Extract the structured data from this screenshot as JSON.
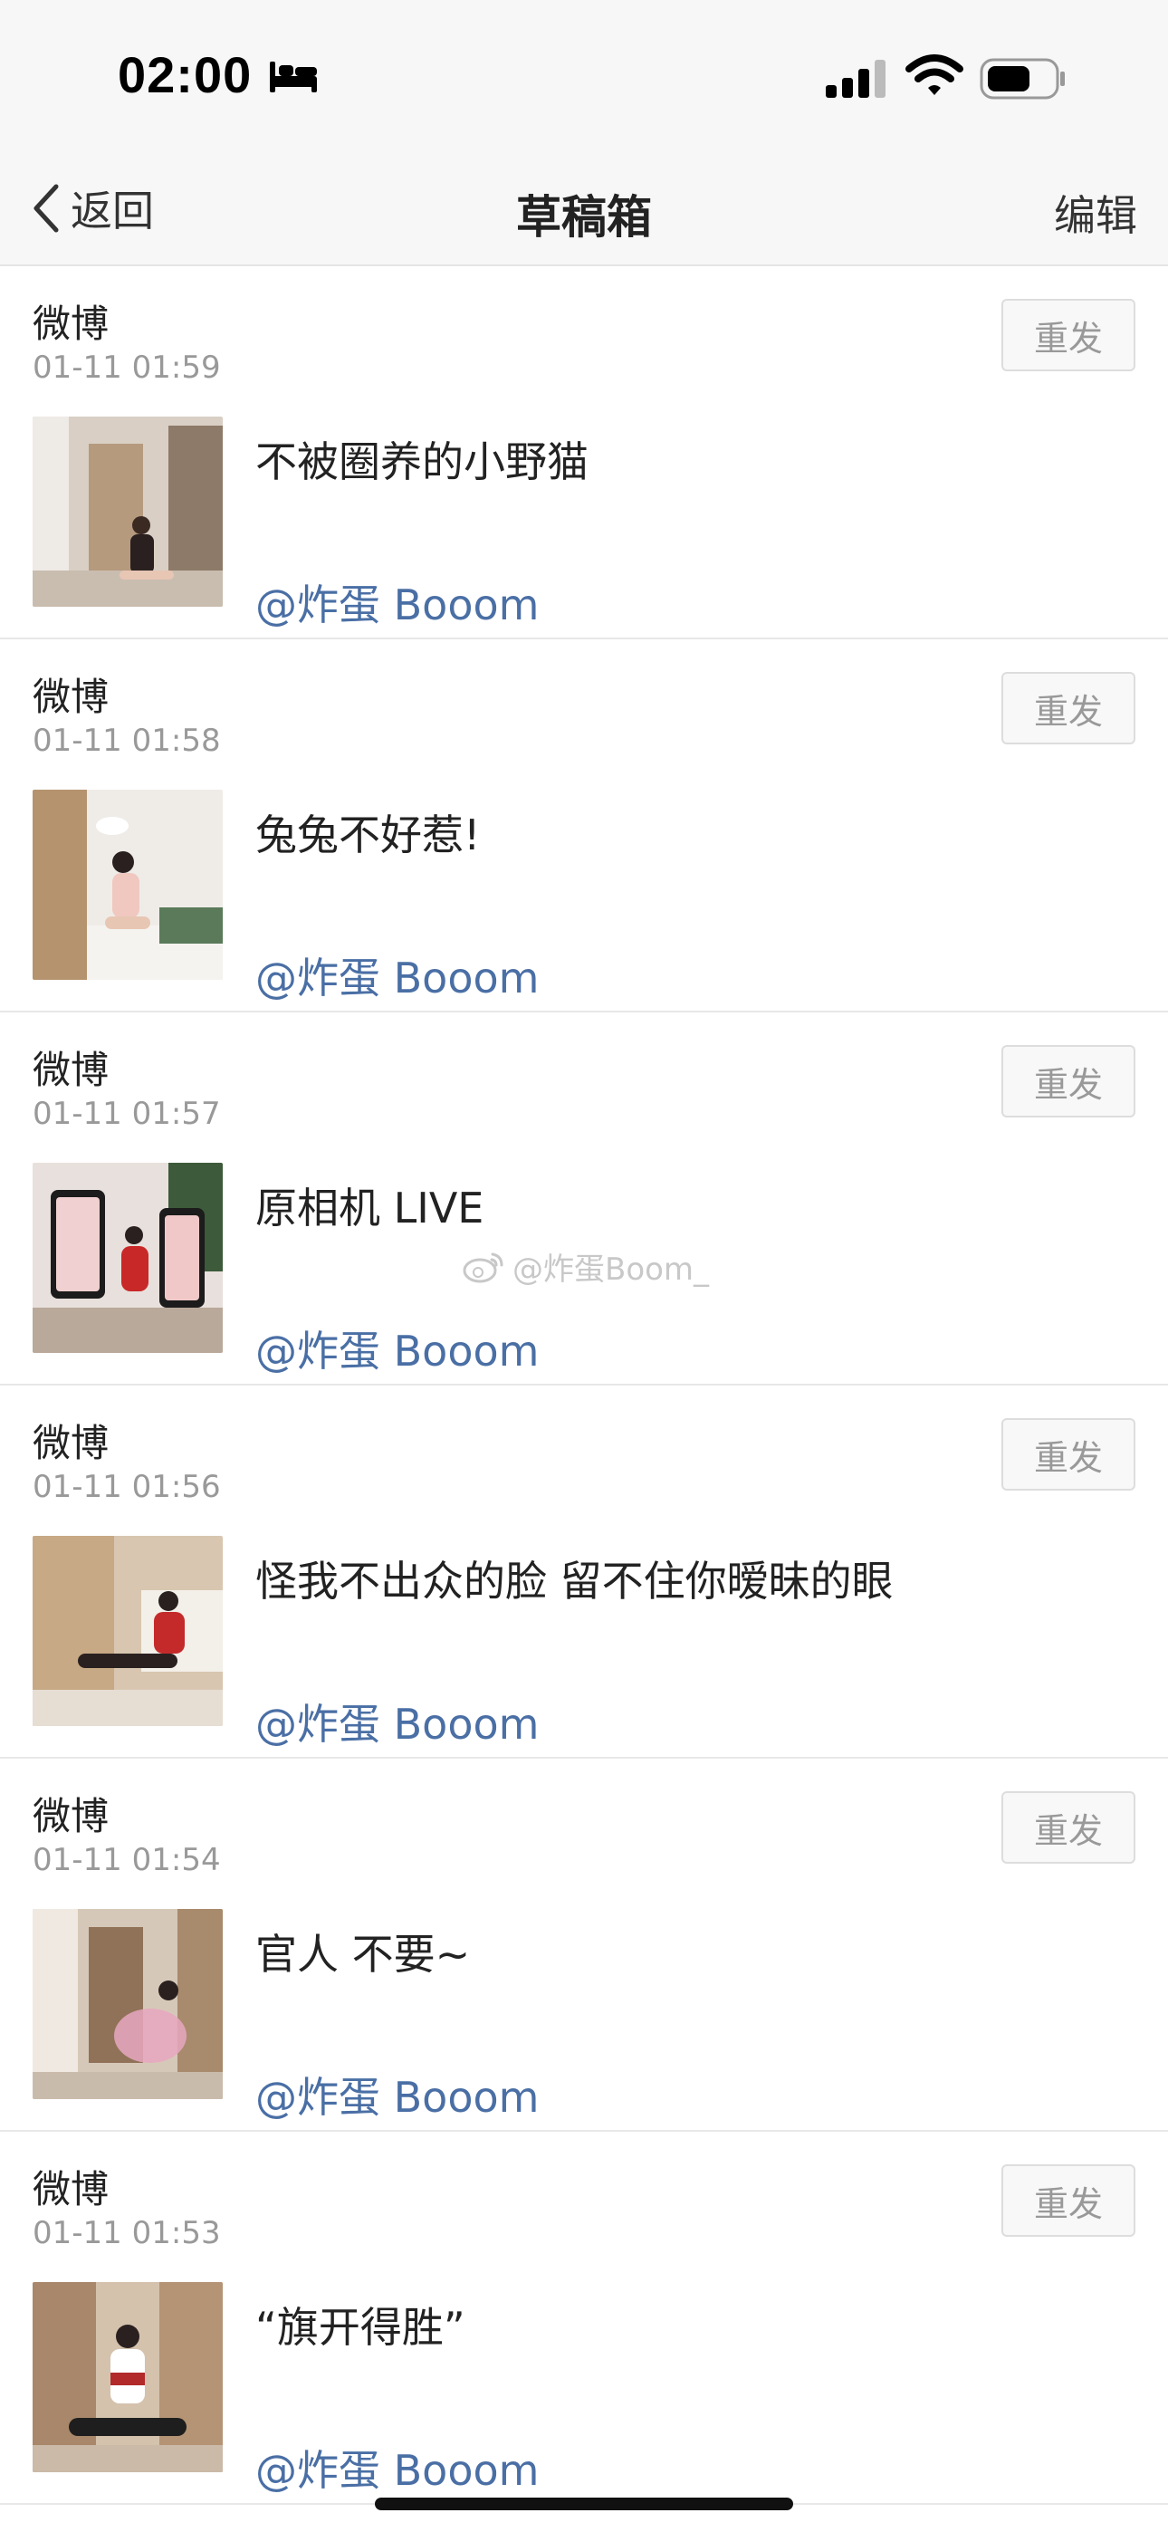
{
  "status_bar": {
    "time": "02:00",
    "icons": [
      "bed-icon",
      "signal-icon",
      "wifi-icon",
      "battery-icon"
    ]
  },
  "nav": {
    "back_label": "返回",
    "title": "草稿箱",
    "edit_label": "编辑"
  },
  "drafts": [
    {
      "source": "微博",
      "time": "01-11 01:59",
      "text": "不被圈养的小野猫",
      "mention": "@炸蛋 Booom",
      "resend": "重发"
    },
    {
      "source": "微博",
      "time": "01-11 01:58",
      "text": "兔兔不好惹!",
      "mention": "@炸蛋 Booom",
      "resend": "重发"
    },
    {
      "source": "微博",
      "time": "01-11 01:57",
      "text": "原相机 LIVE",
      "mention": "@炸蛋 Booom",
      "resend": "重发"
    },
    {
      "source": "微博",
      "time": "01-11 01:56",
      "text": "怪我不出众的脸 留不住你暧昧的眼",
      "mention": "@炸蛋 Booom",
      "resend": "重发"
    },
    {
      "source": "微博",
      "time": "01-11 01:54",
      "text": "官人 不要~",
      "mention": "@炸蛋 Booom",
      "resend": "重发"
    },
    {
      "source": "微博",
      "time": "01-11 01:53",
      "text": "“旗开得胜”",
      "mention": "@炸蛋 Booom",
      "resend": "重发"
    }
  ],
  "watermark": "@炸蛋Boom_",
  "colors": {
    "mention": "#4a6fa5",
    "nav_background": "#f7f7f7",
    "timestamp": "#999999"
  }
}
